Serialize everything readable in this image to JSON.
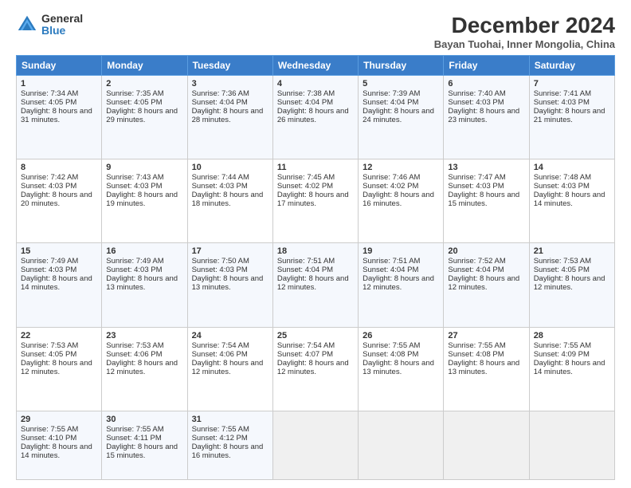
{
  "logo": {
    "general": "General",
    "blue": "Blue"
  },
  "title": "December 2024",
  "location": "Bayan Tuohai, Inner Mongolia, China",
  "headers": [
    "Sunday",
    "Monday",
    "Tuesday",
    "Wednesday",
    "Thursday",
    "Friday",
    "Saturday"
  ],
  "weeks": [
    [
      {
        "day": "1",
        "sunrise": "7:34 AM",
        "sunset": "4:05 PM",
        "daylight": "8 hours and 31 minutes."
      },
      {
        "day": "2",
        "sunrise": "7:35 AM",
        "sunset": "4:05 PM",
        "daylight": "8 hours and 29 minutes."
      },
      {
        "day": "3",
        "sunrise": "7:36 AM",
        "sunset": "4:04 PM",
        "daylight": "8 hours and 28 minutes."
      },
      {
        "day": "4",
        "sunrise": "7:38 AM",
        "sunset": "4:04 PM",
        "daylight": "8 hours and 26 minutes."
      },
      {
        "day": "5",
        "sunrise": "7:39 AM",
        "sunset": "4:04 PM",
        "daylight": "8 hours and 24 minutes."
      },
      {
        "day": "6",
        "sunrise": "7:40 AM",
        "sunset": "4:03 PM",
        "daylight": "8 hours and 23 minutes."
      },
      {
        "day": "7",
        "sunrise": "7:41 AM",
        "sunset": "4:03 PM",
        "daylight": "8 hours and 21 minutes."
      }
    ],
    [
      {
        "day": "8",
        "sunrise": "7:42 AM",
        "sunset": "4:03 PM",
        "daylight": "8 hours and 20 minutes."
      },
      {
        "day": "9",
        "sunrise": "7:43 AM",
        "sunset": "4:03 PM",
        "daylight": "8 hours and 19 minutes."
      },
      {
        "day": "10",
        "sunrise": "7:44 AM",
        "sunset": "4:03 PM",
        "daylight": "8 hours and 18 minutes."
      },
      {
        "day": "11",
        "sunrise": "7:45 AM",
        "sunset": "4:02 PM",
        "daylight": "8 hours and 17 minutes."
      },
      {
        "day": "12",
        "sunrise": "7:46 AM",
        "sunset": "4:02 PM",
        "daylight": "8 hours and 16 minutes."
      },
      {
        "day": "13",
        "sunrise": "7:47 AM",
        "sunset": "4:03 PM",
        "daylight": "8 hours and 15 minutes."
      },
      {
        "day": "14",
        "sunrise": "7:48 AM",
        "sunset": "4:03 PM",
        "daylight": "8 hours and 14 minutes."
      }
    ],
    [
      {
        "day": "15",
        "sunrise": "7:49 AM",
        "sunset": "4:03 PM",
        "daylight": "8 hours and 14 minutes."
      },
      {
        "day": "16",
        "sunrise": "7:49 AM",
        "sunset": "4:03 PM",
        "daylight": "8 hours and 13 minutes."
      },
      {
        "day": "17",
        "sunrise": "7:50 AM",
        "sunset": "4:03 PM",
        "daylight": "8 hours and 13 minutes."
      },
      {
        "day": "18",
        "sunrise": "7:51 AM",
        "sunset": "4:04 PM",
        "daylight": "8 hours and 12 minutes."
      },
      {
        "day": "19",
        "sunrise": "7:51 AM",
        "sunset": "4:04 PM",
        "daylight": "8 hours and 12 minutes."
      },
      {
        "day": "20",
        "sunrise": "7:52 AM",
        "sunset": "4:04 PM",
        "daylight": "8 hours and 12 minutes."
      },
      {
        "day": "21",
        "sunrise": "7:53 AM",
        "sunset": "4:05 PM",
        "daylight": "8 hours and 12 minutes."
      }
    ],
    [
      {
        "day": "22",
        "sunrise": "7:53 AM",
        "sunset": "4:05 PM",
        "daylight": "8 hours and 12 minutes."
      },
      {
        "day": "23",
        "sunrise": "7:53 AM",
        "sunset": "4:06 PM",
        "daylight": "8 hours and 12 minutes."
      },
      {
        "day": "24",
        "sunrise": "7:54 AM",
        "sunset": "4:06 PM",
        "daylight": "8 hours and 12 minutes."
      },
      {
        "day": "25",
        "sunrise": "7:54 AM",
        "sunset": "4:07 PM",
        "daylight": "8 hours and 12 minutes."
      },
      {
        "day": "26",
        "sunrise": "7:55 AM",
        "sunset": "4:08 PM",
        "daylight": "8 hours and 13 minutes."
      },
      {
        "day": "27",
        "sunrise": "7:55 AM",
        "sunset": "4:08 PM",
        "daylight": "8 hours and 13 minutes."
      },
      {
        "day": "28",
        "sunrise": "7:55 AM",
        "sunset": "4:09 PM",
        "daylight": "8 hours and 14 minutes."
      }
    ],
    [
      {
        "day": "29",
        "sunrise": "7:55 AM",
        "sunset": "4:10 PM",
        "daylight": "8 hours and 14 minutes."
      },
      {
        "day": "30",
        "sunrise": "7:55 AM",
        "sunset": "4:11 PM",
        "daylight": "8 hours and 15 minutes."
      },
      {
        "day": "31",
        "sunrise": "7:55 AM",
        "sunset": "4:12 PM",
        "daylight": "8 hours and 16 minutes."
      },
      null,
      null,
      null,
      null
    ]
  ]
}
